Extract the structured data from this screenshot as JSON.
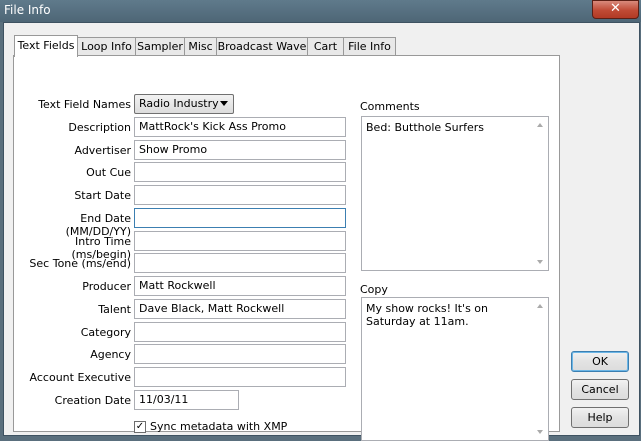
{
  "window": {
    "title": "File Info",
    "close_glyph": "✕"
  },
  "tabs": [
    {
      "label": "Text Fields"
    },
    {
      "label": "Loop Info"
    },
    {
      "label": "Sampler"
    },
    {
      "label": "Misc"
    },
    {
      "label": "Broadcast Wave"
    },
    {
      "label": "Cart"
    },
    {
      "label": "File Info"
    }
  ],
  "form": {
    "text_field_names_label": "Text Field Names",
    "text_field_names_value": "Radio Industry",
    "fields": [
      {
        "label": "Description",
        "value": "MattRock's Kick Ass Promo"
      },
      {
        "label": "Advertiser",
        "value": "Show Promo"
      },
      {
        "label": "Out Cue",
        "value": ""
      },
      {
        "label": "Start Date",
        "value": ""
      },
      {
        "label": "End Date (MM/DD/YY)",
        "value": ""
      },
      {
        "label": "Intro Time (ms/begin)",
        "value": ""
      },
      {
        "label": "Sec Tone (ms/end)",
        "value": ""
      },
      {
        "label": "Producer",
        "value": "Matt Rockwell"
      },
      {
        "label": "Talent",
        "value": "Dave Black, Matt Rockwell"
      },
      {
        "label": "Category",
        "value": ""
      },
      {
        "label": "Agency",
        "value": ""
      },
      {
        "label": "Account Executive",
        "value": ""
      },
      {
        "label": "Creation Date",
        "value": "11/03/11"
      }
    ],
    "sync_label": "Sync metadata with XMP",
    "sync_checked": "✓"
  },
  "comments": {
    "label": "Comments",
    "value": "Bed: Butthole Surfers"
  },
  "copy": {
    "label": "Copy",
    "value": "My show rocks!  It's on Saturday at 11am."
  },
  "buttons": {
    "ok": "OK",
    "cancel": "Cancel",
    "help": "Help"
  }
}
